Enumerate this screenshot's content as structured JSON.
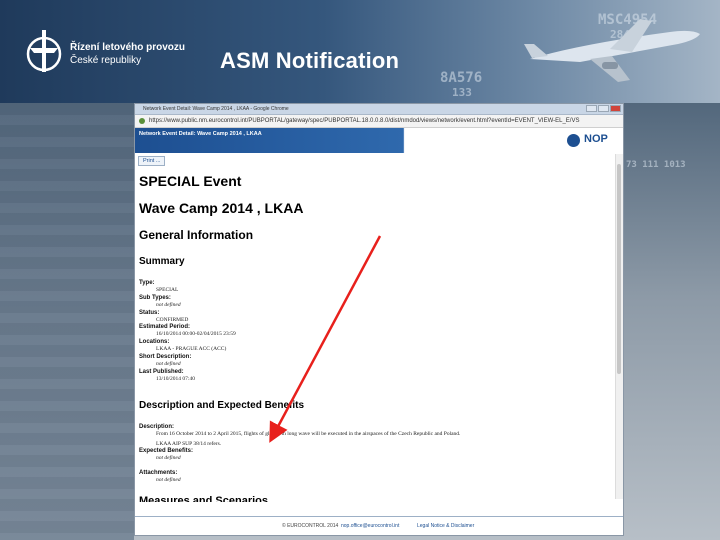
{
  "slide": {
    "title": "ASM Notification",
    "org_line1": "Řízení letového provozu",
    "org_line2": "České republiky",
    "background_numbers": [
      "MSC4954",
      "284",
      "8A576",
      "133",
      "73 111 1013"
    ]
  },
  "browser": {
    "window_title": "Network Event Detail: Wave Camp 2014 , LKAA - Google Chrome",
    "url": "https://www.public.nm.eurocontrol.int/PUBPORTAL/gateway/spec/PUBPORTAL.18.0.0.8.0/dist/nmdod/views/network/event.html?eventId=EVENT_VIEW-EL_E/VS",
    "page_header": "Network Event Detail: Wave Camp 2014 , LKAA",
    "print_label": "Print ...",
    "logo_text": "NOP",
    "icons": [
      "lock-icon",
      "nop-logo-icon",
      "minimize-icon",
      "maximize-icon",
      "close-icon"
    ]
  },
  "event": {
    "type_heading": "SPECIAL Event",
    "name_heading": "Wave Camp 2014 , LKAA",
    "general_info": "General Information",
    "summary": "Summary",
    "fields": [
      {
        "label": "Type:",
        "value": "SPECIAL",
        "italic": false
      },
      {
        "label": "Sub Types:",
        "value": "not defined",
        "italic": true
      },
      {
        "label": "Status:",
        "value": "CONFIRMED",
        "italic": false
      },
      {
        "label": "Estimated Period:",
        "value": "16/10/2014 00:00-02/04/2015 23:59",
        "italic": false
      },
      {
        "label": "Locations:",
        "value": "LKAA - PRAGUE ACC (ACC)",
        "italic": false
      },
      {
        "label": "Short Description:",
        "value": "not defined",
        "italic": true
      },
      {
        "label": "Last Published:",
        "value": "13/10/2014 07:40",
        "italic": false
      }
    ],
    "desc_section": "Description and Expected Benefits",
    "desc_fields": [
      {
        "label": "Description:",
        "value": "From 16 October 2014 to 2 April 2015, flights of gliders in long wave will be executed in the airspaces of the Czech Republic and Poland.",
        "italic": false
      },
      {
        "label": "Expected Benefits:",
        "value": "not defined",
        "italic": true
      },
      {
        "label": "",
        "value": "LKAA AIP SUP 38/14 refers.",
        "italic": false
      },
      {
        "label": "Attachments:",
        "value": "not defined",
        "italic": true
      }
    ],
    "next_section_partial": "Measures and Scenarios"
  },
  "footer": {
    "copyright": "© EUROCONTROL 2014",
    "email": "nop.office@eurocontrol.int",
    "legal": "Legal Notice & Disclaimer"
  },
  "colors": {
    "nop_blue": "#1d4f91",
    "arrow_red": "#e8201c",
    "header_band": "#2a4a6e"
  }
}
